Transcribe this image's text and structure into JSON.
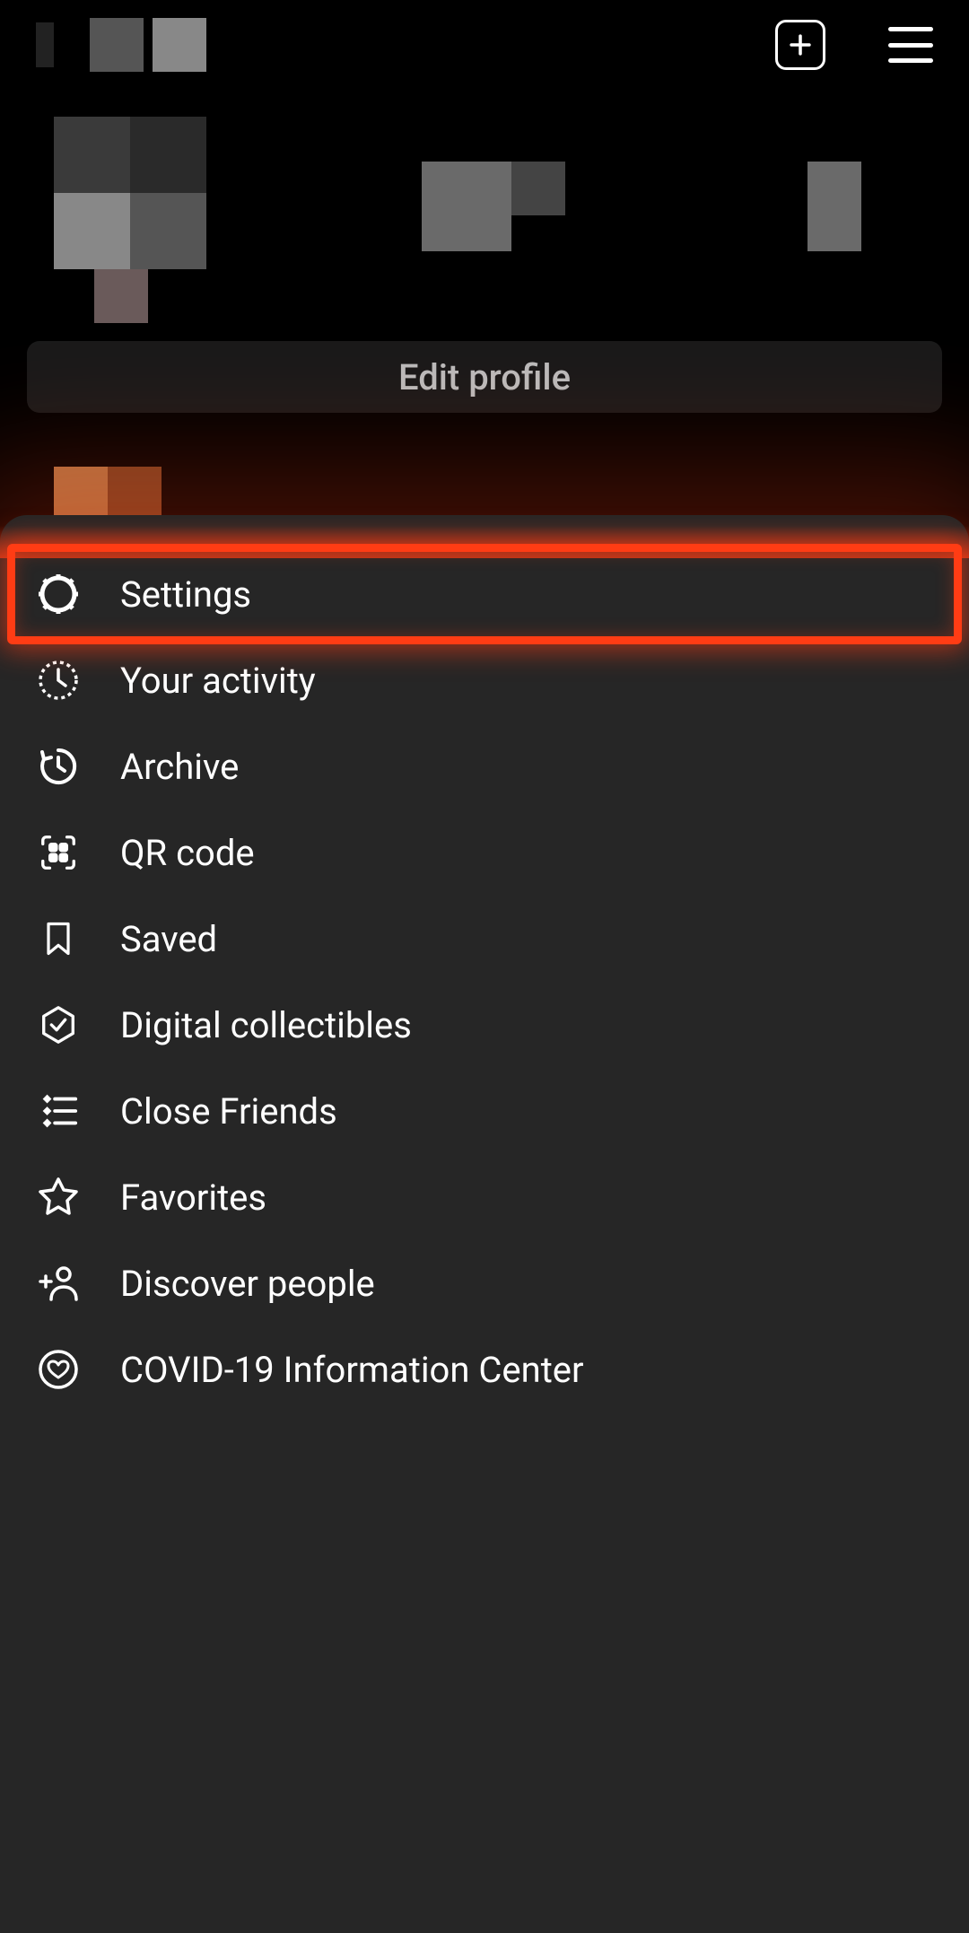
{
  "topbar": {
    "add_icon": "plus",
    "menu_icon": "menu"
  },
  "profile": {
    "edit_button_label": "Edit profile"
  },
  "sheet": {
    "items": [
      {
        "icon": "gear",
        "label": "Settings",
        "highlight": true
      },
      {
        "icon": "activity",
        "label": "Your activity"
      },
      {
        "icon": "archive",
        "label": "Archive"
      },
      {
        "icon": "qr",
        "label": "QR code"
      },
      {
        "icon": "bookmark",
        "label": "Saved"
      },
      {
        "icon": "hexcheck",
        "label": "Digital collectibles"
      },
      {
        "icon": "closefriends",
        "label": "Close Friends"
      },
      {
        "icon": "star",
        "label": "Favorites"
      },
      {
        "icon": "discover",
        "label": "Discover people"
      },
      {
        "icon": "covid",
        "label": "COVID-19 Information Center"
      }
    ]
  }
}
